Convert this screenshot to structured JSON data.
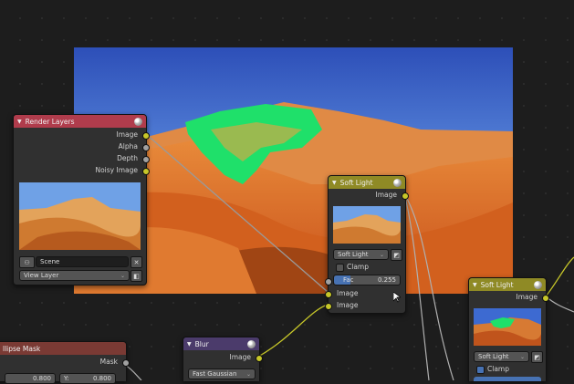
{
  "colors": {
    "render_layers_header": "#b03c4c",
    "soft_light_header": "#8f8a25",
    "blur_header": "#4b3b6b",
    "ellipse_header": "#7a3a34",
    "socket_color": "#c7c729",
    "socket_float": "#a1a1a1",
    "accent_blue": "#4772b3"
  },
  "render_layers": {
    "title": "Render Layers",
    "outputs": [
      "Image",
      "Alpha",
      "Depth",
      "Noisy Image"
    ],
    "scene_value": "Scene",
    "layer_value": "View Layer"
  },
  "soft_light_1": {
    "title": "Soft Light",
    "output": "Image",
    "blend_mode": "Soft Light",
    "clamp_label": "Clamp",
    "clamp_checked": false,
    "fac_label": "Fac",
    "fac_value": "0.255",
    "fac_fraction": 0.255,
    "inputs": [
      "Image",
      "Image"
    ]
  },
  "soft_light_2": {
    "title": "Soft Light",
    "output": "Image",
    "blend_mode": "Soft Light",
    "clamp_label": "Clamp",
    "clamp_checked": true
  },
  "blur": {
    "title": "Blur",
    "output": "Image",
    "filter_type": "Fast Gaussian"
  },
  "ellipse_mask": {
    "title": "llipse Mask",
    "output": "Mask",
    "x_value": "0.800",
    "y_label": "Y:",
    "y_value": "0.800"
  },
  "icons": [
    "render-layers-icon",
    "node-preview-icon",
    "scene-icon",
    "close-icon",
    "view-layer-icon",
    "blend-icon",
    "cursor-icon"
  ]
}
